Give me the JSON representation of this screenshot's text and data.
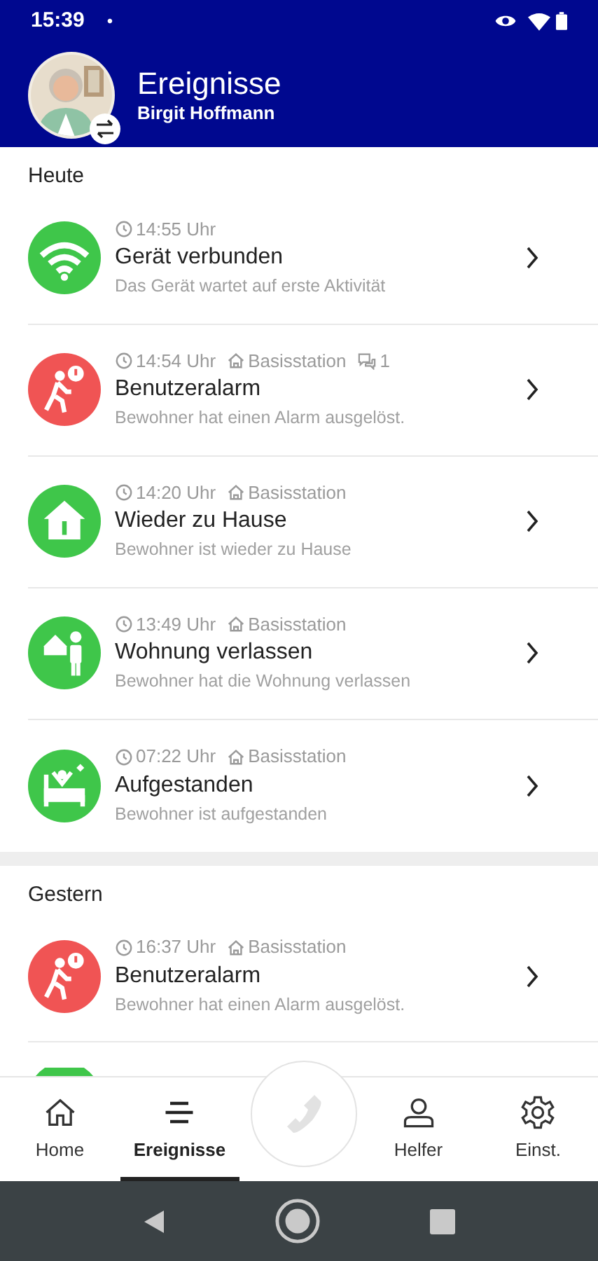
{
  "status_bar": {
    "time": "15:39",
    "dot": "•"
  },
  "header": {
    "title": "Ereignisse",
    "subtitle": "Birgit Hoffmann"
  },
  "sections": [
    {
      "title": "Heute",
      "events": [
        {
          "kind": "wifi",
          "color": "#3fc64a",
          "time": "14:55 Uhr",
          "title": "Gerät verbunden",
          "description": "Das Gerät wartet auf erste Aktivität"
        },
        {
          "kind": "alarm",
          "color": "#f05454",
          "time": "14:54 Uhr",
          "location": "Basisstation",
          "comments": "1",
          "title": "Benutzeralarm",
          "description": "Bewohner hat einen Alarm ausgelöst."
        },
        {
          "kind": "home",
          "color": "#3fc64a",
          "time": "14:20 Uhr",
          "location": "Basisstation",
          "title": "Wieder zu Hause",
          "description": "Bewohner ist wieder zu Hause"
        },
        {
          "kind": "leave",
          "color": "#3fc64a",
          "time": "13:49 Uhr",
          "location": "Basisstation",
          "title": "Wohnung verlassen",
          "description": "Bewohner hat die Wohnung verlassen"
        },
        {
          "kind": "getup",
          "color": "#3fc64a",
          "time": "07:22 Uhr",
          "location": "Basisstation",
          "title": "Aufgestanden",
          "description": "Bewohner ist aufgestanden"
        }
      ]
    },
    {
      "title": "Gestern",
      "events": [
        {
          "kind": "alarm",
          "color": "#f05454",
          "time": "16:37 Uhr",
          "location": "Basisstation",
          "title": "Benutzeralarm",
          "description": "Bewohner hat einen Alarm ausgelöst."
        },
        {
          "kind": "partial",
          "color": "#3fc64a"
        }
      ]
    }
  ],
  "nav": [
    {
      "kind": "home",
      "label": "Home",
      "selected": false
    },
    {
      "kind": "events",
      "label": "Ereignisse",
      "selected": true
    },
    {
      "kind": "call"
    },
    {
      "kind": "helper",
      "label": "Helfer",
      "selected": false
    },
    {
      "kind": "settings",
      "label": "Einst.",
      "selected": false
    }
  ]
}
